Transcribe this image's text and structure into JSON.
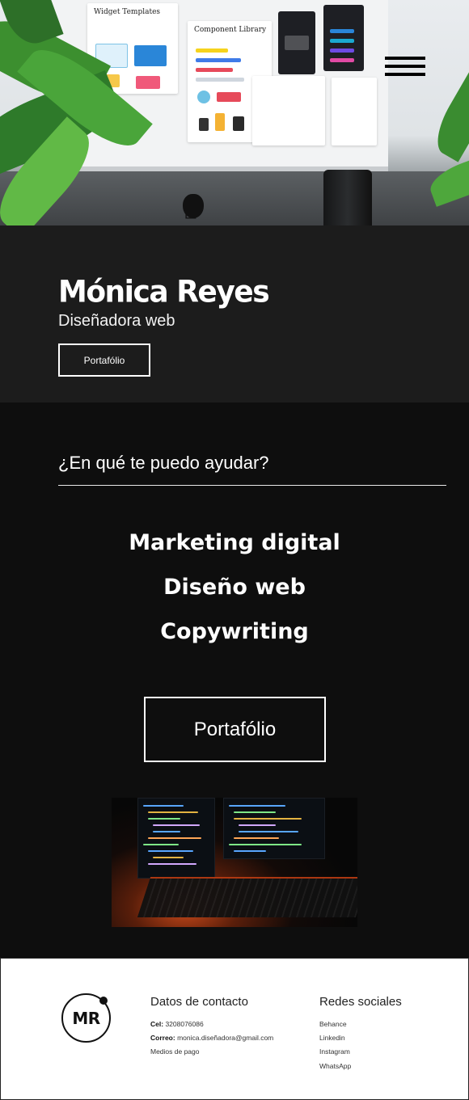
{
  "hero": {
    "cards": {
      "widget_title": "Widget Templates",
      "component_title": "Component Library"
    },
    "menu_icon": "hamburger-menu-icon"
  },
  "intro": {
    "name": "Mónica Reyes",
    "role": "Diseñadora web",
    "button_label": "Portafólio"
  },
  "services": {
    "heading": "¿En qué te puedo ayudar?",
    "items": [
      "Marketing digital",
      "Diseño web",
      "Copywriting"
    ],
    "button_label": "Portafólio"
  },
  "footer": {
    "logo_text": "MR",
    "contact": {
      "title": "Datos de contacto",
      "phone_label": "Cel:",
      "phone_value": "3208076086",
      "email_label": "Correo:",
      "email_value": "monica.diseñadora@gmail.com",
      "payment_link": "Medios de pago"
    },
    "social": {
      "title": "Redes sociales",
      "links": [
        "Behance",
        "Linkedin",
        "Instagram",
        "WhatsApp"
      ]
    }
  },
  "colors": {
    "intro_bg": "#1c1c1c",
    "services_bg": "#0e0e0e",
    "footer_bg": "#ffffff",
    "text_light": "#ffffff"
  }
}
